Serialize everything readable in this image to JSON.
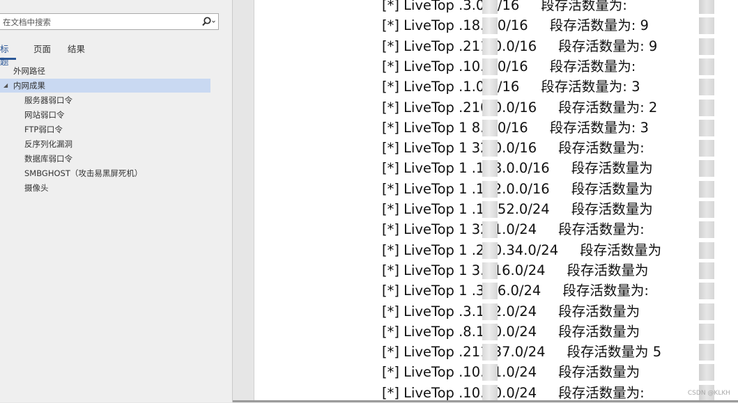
{
  "nav": {
    "search": {
      "placeholder": "在文档中搜索"
    },
    "tabs": [
      {
        "label": "标题",
        "active": true
      },
      {
        "label": "页面",
        "active": false
      },
      {
        "label": "结果",
        "active": false
      }
    ],
    "tree": [
      {
        "label": "外网路径",
        "level": 1,
        "expanded": null,
        "selected": false
      },
      {
        "label": "内网成果",
        "level": 1,
        "expanded": true,
        "selected": true
      },
      {
        "label": "服务器弱口令",
        "level": 2
      },
      {
        "label": "网站弱口令",
        "level": 2
      },
      {
        "label": "FTP弱口令",
        "level": 2
      },
      {
        "label": "反序列化漏洞",
        "level": 2
      },
      {
        "label": "数据库弱口令",
        "level": 2
      },
      {
        "label": "SMBGHOST（攻击易黑屏死机）",
        "level": 2
      },
      {
        "label": "摄像头",
        "level": 2
      }
    ]
  },
  "document": {
    "lines": [
      {
        "prefix": "[*] LiveTop ",
        "visible_ip": ".3.0.0/16",
        "label": "段存活数量为:"
      },
      {
        "prefix": "[*] LiveTop ",
        "visible_ip": ".18.0.0/16",
        "label": "段存活数量为:",
        "count": "9"
      },
      {
        "prefix": "[*] LiveTop ",
        "visible_ip": ".211.0.0/16",
        "label": "段存活数量为:",
        "count": "9"
      },
      {
        "prefix": "[*] LiveTop ",
        "visible_ip": ".10.0.0/16",
        "label": "段存活数量为:"
      },
      {
        "prefix": "[*] LiveTop ",
        "visible_ip": ".1.0.0/16",
        "label": "段存活数量为:",
        "count": "3"
      },
      {
        "prefix": "[*] LiveTop ",
        "visible_ip": ".210.0.0/16",
        "label": "段存活数量为:",
        "count": "2"
      },
      {
        "prefix": "[*] LiveTop ",
        "visible_ip": "1 8.0.0/16",
        "label": "段存活数量为:",
        "count": "3"
      },
      {
        "prefix": "[*] LiveTop ",
        "visible_ip": "1 32.0.0/16",
        "label": "段存活数量为:"
      },
      {
        "prefix": "[*] LiveTop ",
        "visible_ip": "1 .128.0.0/16",
        "label": "段存活数量为"
      },
      {
        "prefix": "[*] LiveTop ",
        "visible_ip": "1 .192.0.0/16",
        "label": "段存活数量为"
      },
      {
        "prefix": "[*] LiveTop ",
        "visible_ip": "1 .18.52.0/24",
        "label": "段存活数量为"
      },
      {
        "prefix": "[*] LiveTop ",
        "visible_ip": "1 32.1.0/24",
        "label": "段存活数量为:"
      },
      {
        "prefix": "[*] LiveTop ",
        "visible_ip": "1 .210.34.0/24",
        "label": "段存活数量为"
      },
      {
        "prefix": "[*] LiveTop ",
        "visible_ip": "1 3.216.0/24",
        "label": "段存活数量为"
      },
      {
        "prefix": "[*] LiveTop ",
        "visible_ip": "1 .32.6.0/24",
        "label": "段存活数量为:"
      },
      {
        "prefix": "[*] LiveTop ",
        "visible_ip": ".3.122.0/24",
        "label": "段存活数量为"
      },
      {
        "prefix": "[*] LiveTop ",
        "visible_ip": ".8.100.0/24",
        "label": "段存活数量为"
      },
      {
        "prefix": "[*] LiveTop ",
        "visible_ip": ".211.37.0/24",
        "label": "段存活数量为",
        "count": "5"
      },
      {
        "prefix": "[*] LiveTop ",
        "visible_ip": ".10.51.0/24",
        "label": "段存活数量为"
      },
      {
        "prefix": "[*] LiveTop ",
        "visible_ip": ".10.50.0/24",
        "label": "段存活数量为:"
      }
    ],
    "watermark": "CSDN @KLKH"
  }
}
